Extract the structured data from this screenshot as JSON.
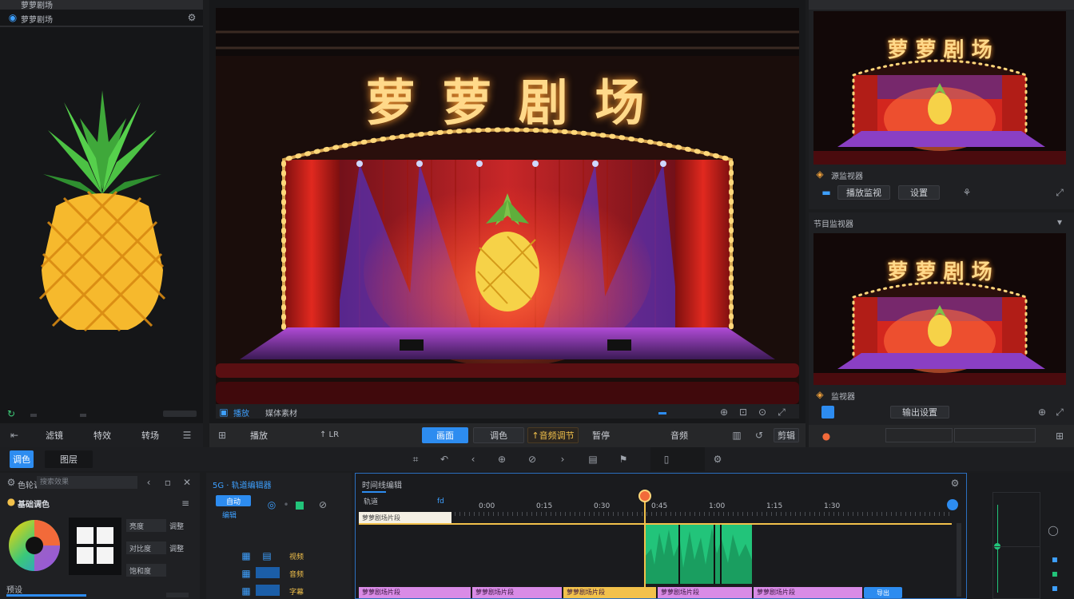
{
  "left_panel": {
    "tab1": "萝萝剧场",
    "tab2": "萝萝剧场",
    "bottom_buttons": [
      "滤镜",
      "特效",
      "转场"
    ]
  },
  "preview": {
    "sign_text": "萝 萝 剧 场",
    "tab_label": "播放",
    "tab_label2": "媒体素材",
    "controls": [
      "播放",
      "暂停",
      "剪辑"
    ],
    "mode_tabs": [
      "画面",
      "调色",
      "↑音频调节"
    ],
    "right_buttons": [
      "音频"
    ],
    "side_label": "↑ LR"
  },
  "right_top": {
    "sign_text": "萝 萝 剧 场",
    "title": "源监视器",
    "btn1": "播放监视",
    "btn2": "设置"
  },
  "right_mid": {
    "title": "节目监视器",
    "sign_text": "萝 萝 剧 场",
    "footer_title": "监视器",
    "footer_btn": "输出设置"
  },
  "toolbar_bottom_left": {
    "tab_active": "调色",
    "tab2": "图层"
  },
  "color_panel": {
    "search_placeholder": "搜索效果",
    "title": "基础调色",
    "title2": "色轮调色",
    "rows": [
      "亮度",
      "对比度",
      "饱和度"
    ],
    "row_values": [
      "调整",
      "调整",
      ""
    ],
    "footer": "预设"
  },
  "track_panel": {
    "title": "5G · 轨道编辑器",
    "badge": "自动",
    "sub": "编辑",
    "track_labels": [
      "视频",
      "音频",
      "字幕"
    ]
  },
  "timeline": {
    "title": "时间线编辑",
    "marker": "轨道",
    "ruler": [
      "0:00",
      "0:15",
      "0:30",
      "0:45",
      "1:00",
      "1:15",
      "1:30"
    ],
    "clip_labels": [
      "萝萝剧场片段",
      "萝萝剧场片段",
      "萝萝剧场片段",
      "萝萝剧场片段",
      "萝萝剧场片段",
      "萝萝剧场片段"
    ],
    "end_badge": "导出"
  },
  "colors": {
    "accent": "#2d8cf0",
    "gold": "#f2c14b",
    "green_clip": "#22c47a",
    "pink_clip": "#d98be6",
    "yellow_clip": "#f2c14b",
    "curtain": "#d3261e"
  },
  "icons": [
    "settings-icon",
    "play-icon",
    "prev-icon",
    "next-icon",
    "undo-icon",
    "redo-icon",
    "split-icon",
    "windows-icon",
    "color-wheel-icon",
    "pineapple-icon",
    "playhead-icon"
  ]
}
